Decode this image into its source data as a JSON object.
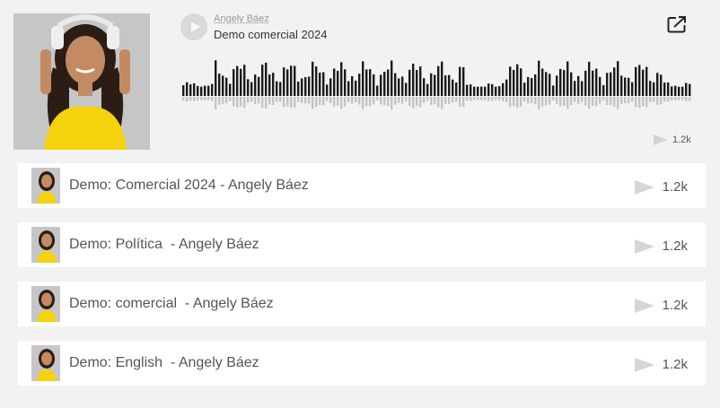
{
  "player": {
    "artist": "Angely Báez",
    "title": "Demo comercial 2024",
    "play_count": "1.2k"
  },
  "tracks": [
    {
      "title": "Demo: Comercial 2024 - Angely Báez",
      "plays": "1.2k"
    },
    {
      "title": "Demo: Política  - Angely Báez",
      "plays": "1.2k"
    },
    {
      "title": "Demo: comercial  - Angely Báez",
      "plays": "1.2k"
    },
    {
      "title": "Demo: English  - Angely Báez",
      "plays": "1.2k"
    }
  ],
  "colors": {
    "background": "#f2f2f2",
    "waveform": "#1a1a1a",
    "waveform_reflection": "#c4c4c4",
    "row_background": "#ffffff",
    "accent_yellow": "#f4d20c"
  },
  "icons": [
    "play-icon",
    "share-icon",
    "play-count-icon"
  ]
}
